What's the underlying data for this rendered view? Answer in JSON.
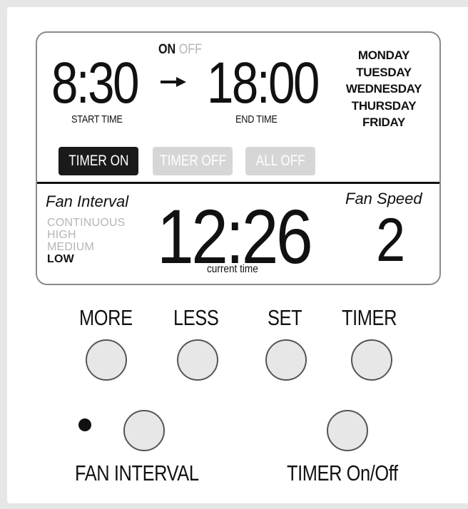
{
  "schedule": {
    "on_label": "ON",
    "off_label": "OFF",
    "start_time": "8:30",
    "end_time": "18:00",
    "start_caption": "START TIME",
    "end_caption": "END TIME",
    "days": [
      "MONDAY",
      "TUESDAY",
      "WEDNESDAY",
      "THURSDAY",
      "FRIDAY"
    ]
  },
  "modes": {
    "timer_on": "TIMER ON",
    "timer_off": "TIMER OFF",
    "all_off": "ALL OFF",
    "active": "timer_on"
  },
  "fan": {
    "interval_title": "Fan Interval",
    "interval_options": [
      "CONTINUOUS",
      "HIGH",
      "MEDIUM",
      "LOW"
    ],
    "interval_selected": "LOW",
    "speed_title": "Fan Speed",
    "speed_value": "2"
  },
  "clock": {
    "current_time": "12:26",
    "caption": "current time"
  },
  "keys": {
    "more": "MORE",
    "less": "LESS",
    "set": "SET",
    "timer": "TIMER",
    "fan_interval": "FAN INTERVAL",
    "timer_onoff": "TIMER On/Off"
  },
  "colors": {
    "active_mode_bg": "#1a1a1a",
    "inactive_mode_bg": "#d4d4d4",
    "inactive_text": "#b5b5b5",
    "lcd_border": "#8a8a8a"
  }
}
